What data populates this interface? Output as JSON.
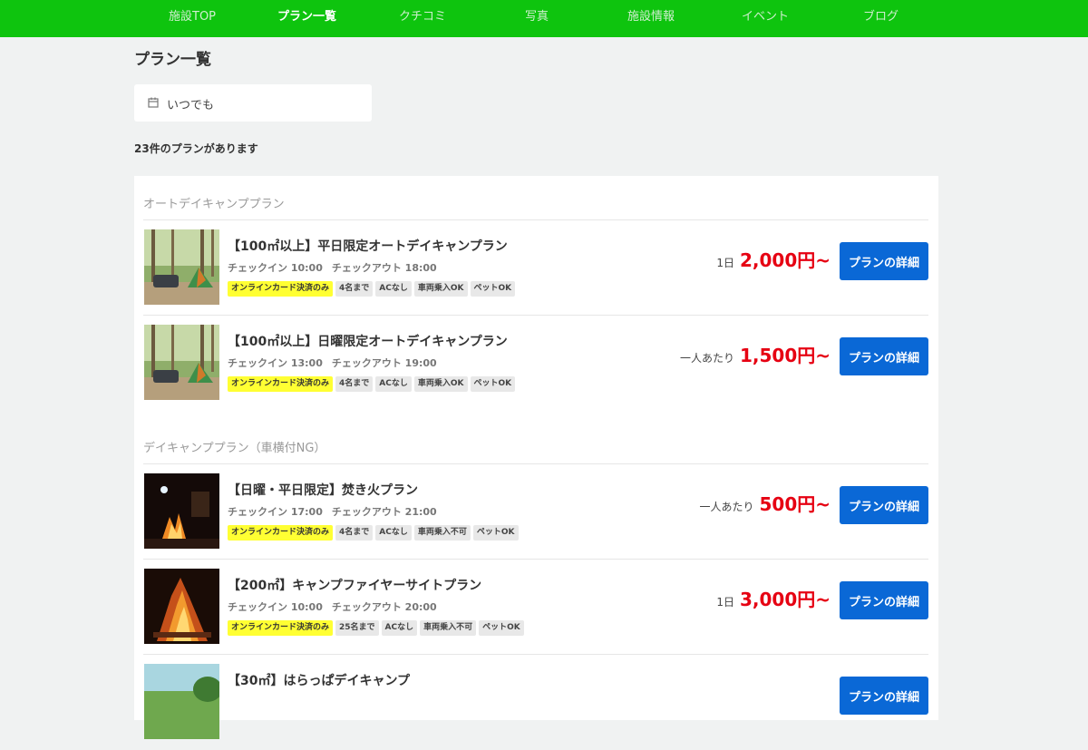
{
  "nav": {
    "tabs": [
      {
        "label": "施設TOP"
      },
      {
        "label": "プラン一覧"
      },
      {
        "label": "クチコミ"
      },
      {
        "label": "写真"
      },
      {
        "label": "施設情報"
      },
      {
        "label": "イベント"
      },
      {
        "label": "ブログ"
      }
    ],
    "active_index": 1,
    "color": "#0ec40e"
  },
  "page": {
    "title": "プラン一覧",
    "date_filter": {
      "label": "いつでも",
      "icon": "calendar-icon"
    },
    "count_text": "23件のプランがあります"
  },
  "sections": [
    {
      "title": "オートデイキャンププラン",
      "plans": [
        {
          "name": "【100㎡以上】平日限定オートデイキャンプラン",
          "checkin": "チェックイン 10:00",
          "checkout": "チェックアウト 18:00",
          "tags": [
            "オンラインカード決済のみ",
            "4名まで",
            "ACなし",
            "車両乗入OK",
            "ペットOK"
          ],
          "price_unit": "1日",
          "price": "2,000円~",
          "button": "プランの詳細",
          "image": "forest-car-camp"
        },
        {
          "name": "【100㎡以上】日曜限定オートデイキャンプラン",
          "checkin": "チェックイン 13:00",
          "checkout": "チェックアウト 19:00",
          "tags": [
            "オンラインカード決済のみ",
            "4名まで",
            "ACなし",
            "車両乗入OK",
            "ペットOK"
          ],
          "price_unit": "一人あたり",
          "price": "1,500円~",
          "button": "プランの詳細",
          "image": "forest-car-camp"
        }
      ]
    },
    {
      "title": "デイキャンププラン（車横付NG）",
      "plans": [
        {
          "name": "【日曜・平日限定】焚き火プラン",
          "checkin": "チェックイン 17:00",
          "checkout": "チェックアウト 21:00",
          "tags": [
            "オンラインカード決済のみ",
            "4名まで",
            "ACなし",
            "車両乗入不可",
            "ペットOK"
          ],
          "price_unit": "一人あたり",
          "price": "500円~",
          "button": "プランの詳細",
          "image": "night-bonfire"
        },
        {
          "name": "【200㎡】キャンプファイヤーサイトプラン",
          "checkin": "チェックイン 10:00",
          "checkout": "チェックアウト 20:00",
          "tags": [
            "オンラインカード決済のみ",
            "25名まで",
            "ACなし",
            "車両乗入不可",
            "ペットOK"
          ],
          "price_unit": "1日",
          "price": "3,000円~",
          "button": "プランの詳細",
          "image": "campfire"
        },
        {
          "name": "【30㎡】はらっぱデイキャンプ",
          "checkin": "",
          "checkout": "",
          "tags": [],
          "price_unit": "",
          "price": "",
          "button": "プランの詳細",
          "image": "meadow"
        }
      ]
    }
  ]
}
